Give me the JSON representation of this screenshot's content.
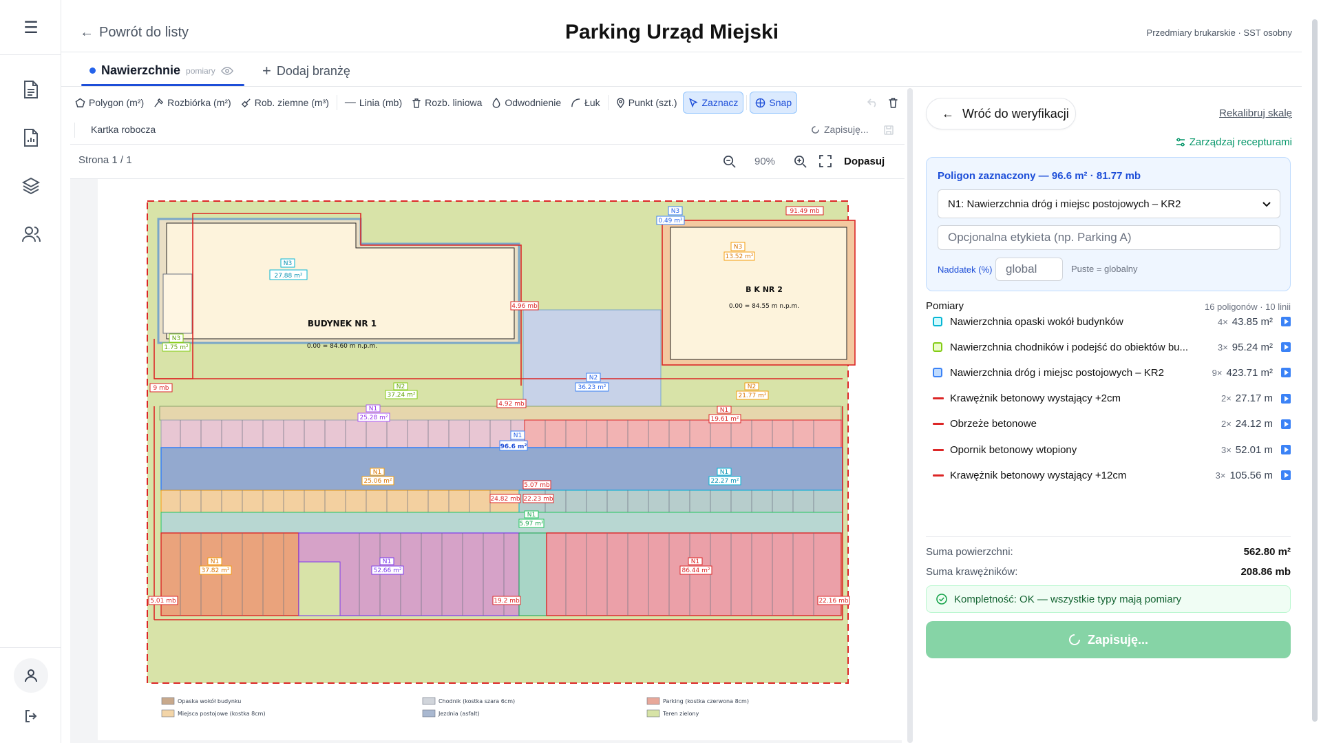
{
  "header": {
    "back_label": "Powrót do listy",
    "title": "Parking Urząd Miejski",
    "meta": "Przedmiary brukarskie · SST osobny"
  },
  "tabs": [
    {
      "label": "Nawierzchnie",
      "sub": "pomiary"
    },
    {
      "label": "Dodaj branżę"
    }
  ],
  "toolbar": {
    "items": [
      {
        "label": "Polygon (m²)",
        "icon": "polygon-icon"
      },
      {
        "label": "Rozbiórka (m²)",
        "icon": "hammer-icon"
      },
      {
        "label": "Rob. ziemne (m³)",
        "icon": "shovel-icon"
      },
      {
        "label": "Linia (mb)",
        "icon": "line-icon"
      },
      {
        "label": "Rozb. liniowa",
        "icon": "trash-icon"
      },
      {
        "label": "Odwodnienie",
        "icon": "drop-icon"
      },
      {
        "label": "Łuk",
        "icon": "arc-icon"
      },
      {
        "label": "Punkt (szt.)",
        "icon": "pin-icon"
      },
      {
        "label": "Zaznacz",
        "icon": "cursor-icon"
      },
      {
        "label": "Snap",
        "icon": "magnet-icon"
      }
    ],
    "worksheet": "Kartka robocza",
    "saving": "Zapisuję..."
  },
  "viewer": {
    "page": "Strona 1 / 1",
    "zoom": "90%",
    "fit": "Dopasuj"
  },
  "plan": {
    "bldg1_name": "BUDYNEK NR 1",
    "bldg1_level": "0.00 = 84.60 m n.p.m.",
    "bldg2_name": "B  K NR 2",
    "bldg2_level": "0.00 = 84.55 m n.p.m.",
    "labels": {
      "n3a": "N3",
      "n3a_v": "27.88 m²",
      "n3b": "N3",
      "n3b_v": "0.49 m²",
      "n3c": "N3",
      "n3c_v": "13.52 m²",
      "n3d": "N3",
      "n3d_v": "1.75 m²",
      "mb1": "91.49 mb",
      "mb2": "4.96 mb",
      "mb3": "9 mb",
      "mb4": "4.92 mb",
      "mb5": "5.07 mb",
      "mb6": "24.82 mb",
      "mb7": "22.23 mb",
      "mb8": "5.01 mb",
      "mb9": "19.2 mb",
      "mb10": "22.16 mb",
      "n2a": "N2",
      "n2a_v": "36.23 m²",
      "n2b": "N2",
      "n2b_v": "37.24 m²",
      "n2c": "N2",
      "n2c_v": "21.77 m²",
      "n1a": "N1",
      "n1a_v": "25.28 m²",
      "n1b": "N1",
      "n1b_v": "19.61 m²",
      "n1c": "N1",
      "n1c_v": "96.6 m²",
      "n1d": "N1",
      "n1d_v": "25.06 m²",
      "n1e": "N1",
      "n1e_v": "22.27 m²",
      "n1f": "N1",
      "n1f_v": "37.82 m²",
      "n1g": "N1",
      "n1g_v": "52.66 m²",
      "n1h": "N1",
      "n1h_v": "5.97 m²",
      "n1i": "N1",
      "n1i_v": "86.44 m²"
    },
    "legend": [
      {
        "label": "Opaska wokół budynku",
        "color": "#c8a98c"
      },
      {
        "label": "Chodnik (kostka szara 6cm)",
        "color": "#d1d5db"
      },
      {
        "label": "Parking (kostka czerwona 8cm)",
        "color": "#e8a89a"
      },
      {
        "label": "Miejsca postojowe (kostka 8cm)",
        "color": "#f3d5a8"
      },
      {
        "label": "Jezdnia (asfalt)",
        "color": "#a9b8d0"
      },
      {
        "label": "Teren zielony",
        "color": "#d7e3a6"
      }
    ]
  },
  "panel": {
    "back_label": "Wróć do weryfikacji",
    "recalibrate": "Rekalibruj skalę",
    "manage_recipes": "Zarządzaj recepturami",
    "selected_header": "Poligon zaznaczony — 96.6 m² · 81.77 mb",
    "selected_type": "N1: Nawierzchnia dróg i miejsc postojowych – KR2",
    "label_placeholder": "Opcjonalna etykieta (np. Parking A)",
    "naddatek_label": "Naddatek (%)",
    "naddatek_placeholder": "global",
    "naddatek_hint": "Puste = globalny",
    "measures_title": "Pomiary",
    "measures_count": "16 poligonów · 10 linii",
    "measures": [
      {
        "name": "Nawierzchnia opaski wokół budynków",
        "count": "4×",
        "value": "43.85 m²",
        "kind": "area",
        "color": "#06b6d4",
        "fill": "#cffafe"
      },
      {
        "name": "Nawierzchnia chodników i podejść do obiektów bu...",
        "count": "3×",
        "value": "95.24 m²",
        "kind": "area",
        "color": "#84cc16",
        "fill": "#ecfccb"
      },
      {
        "name": "Nawierzchnia dróg i miejsc postojowych – KR2",
        "count": "9×",
        "value": "423.71 m²",
        "kind": "area",
        "color": "#3b82f6",
        "fill": "#bfdbfe"
      },
      {
        "name": "Krawężnik betonowy wystający +2cm",
        "count": "2×",
        "value": "27.17 m",
        "kind": "line",
        "color": "#dc2626"
      },
      {
        "name": "Obrzeże betonowe",
        "count": "2×",
        "value": "24.12 m",
        "kind": "line",
        "color": "#dc2626"
      },
      {
        "name": "Opornik betonowy wtopiony",
        "count": "3×",
        "value": "52.01 m",
        "kind": "line",
        "color": "#dc2626"
      },
      {
        "name": "Krawężnik betonowy wystający +12cm",
        "count": "3×",
        "value": "105.56 m",
        "kind": "line",
        "color": "#dc2626"
      }
    ],
    "sum_area_label": "Suma powierzchni:",
    "sum_area": "562.80 m²",
    "sum_curb_label": "Suma krawężników:",
    "sum_curb": "208.86 mb",
    "ok_text": "Kompletność: OK — wszystkie typy mają pomiary",
    "save_label": "Zapisuję..."
  }
}
